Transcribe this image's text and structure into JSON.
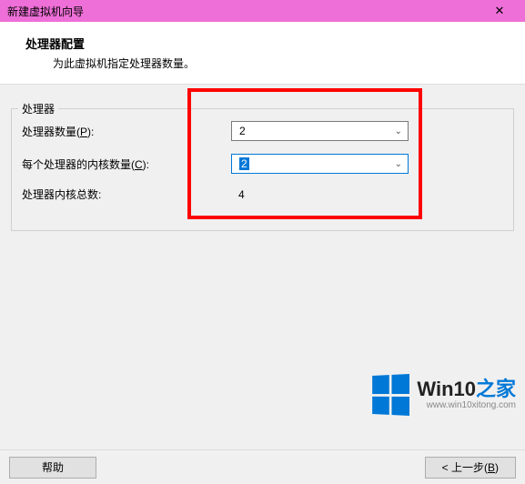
{
  "window": {
    "title": "新建虚拟机向导",
    "close": "✕"
  },
  "header": {
    "title": "处理器配置",
    "subtitle": "为此虚拟机指定处理器数量。"
  },
  "fieldset": {
    "legend": "处理器"
  },
  "labels": {
    "processors_prefix": "处理器数量(",
    "processors_hotkey": "P",
    "processors_suffix": "):",
    "cores_prefix": "每个处理器的内核数量(",
    "cores_hotkey": "C",
    "cores_suffix": "):",
    "total": "处理器内核总数:"
  },
  "values": {
    "processors": "2",
    "cores": "2",
    "total": "4"
  },
  "buttons": {
    "help": "帮助",
    "back_prefix": "< 上一步(",
    "back_hotkey": "B",
    "back_suffix": ")"
  },
  "watermark": {
    "brand_part1": "Win10",
    "brand_part2": "之家",
    "url": "www.win10xitong.com"
  }
}
